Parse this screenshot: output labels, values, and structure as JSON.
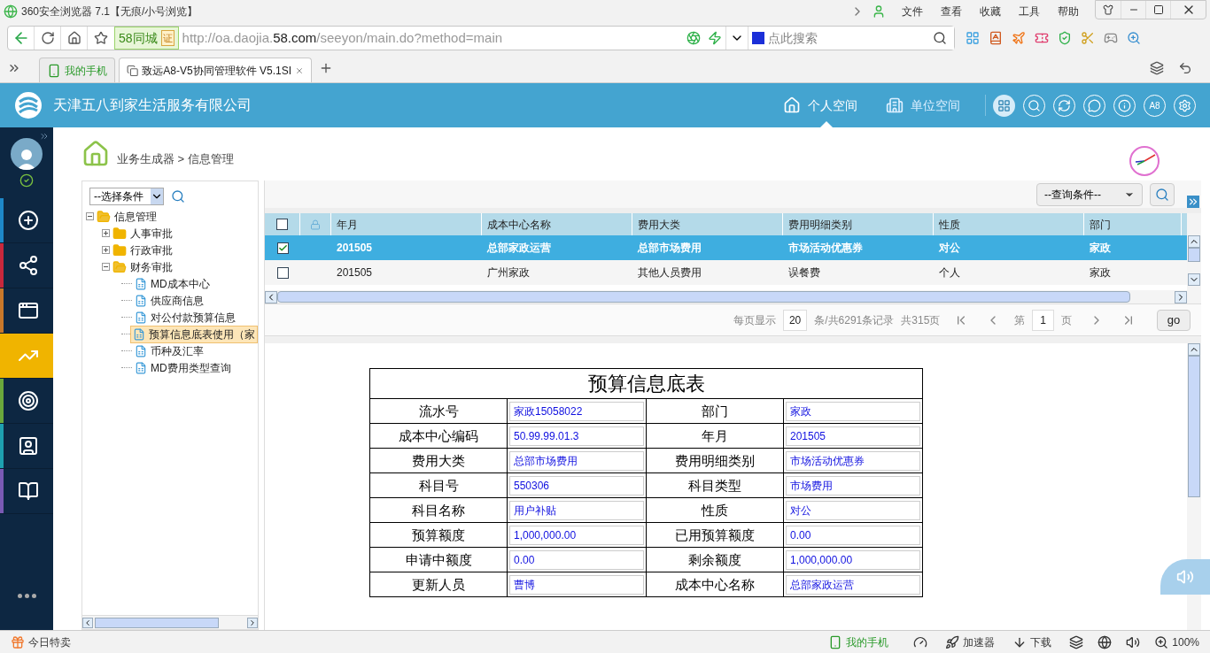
{
  "browser": {
    "title": "360安全浏览器 7.1【无痕/小号浏览】",
    "menu": [
      "文件",
      "查看",
      "收藏",
      "工具",
      "帮助"
    ],
    "site_badge": "58同城",
    "cert": "证",
    "url_before": "http://oa.daojia.",
    "url_domain": "58.com",
    "url_after": "/seeyon/main.do?method=main",
    "search_placeholder": "点此搜索"
  },
  "tabs": [
    {
      "label": "我的手机",
      "kind": "phone",
      "selected": false
    },
    {
      "label": "致远A8-V5协同管理软件 V5.1SI",
      "kind": "page",
      "selected": true
    }
  ],
  "app": {
    "company": "天津五八到家生活服务有限公司",
    "spaces": [
      {
        "label": "个人空间",
        "kind": "home",
        "selected": true
      },
      {
        "label": "单位空间",
        "kind": "building",
        "selected": false
      }
    ],
    "tools": [
      {
        "kind": "grid",
        "selected": true
      },
      {
        "kind": "search",
        "selected": false
      },
      {
        "kind": "refresh",
        "selected": false
      },
      {
        "kind": "chat",
        "selected": false
      },
      {
        "kind": "info",
        "selected": false
      },
      {
        "kind": "text",
        "label": "A8",
        "selected": false
      },
      {
        "kind": "settings",
        "selected": false
      }
    ]
  },
  "nav": [
    {
      "kind": "add",
      "color": "#1e88c8",
      "selected": false
    },
    {
      "kind": "flow",
      "color": "#c8283c",
      "selected": false
    },
    {
      "kind": "window",
      "color": "#c8782a",
      "selected": false
    },
    {
      "kind": "chart",
      "color": "#f0b400",
      "selected": true
    },
    {
      "kind": "target",
      "color": "#6aa83c",
      "selected": false
    },
    {
      "kind": "person",
      "color": "#1ea0b0",
      "selected": false
    },
    {
      "kind": "book",
      "color": "#7a5ab4",
      "selected": false
    }
  ],
  "breadcrumb": "业务生成器 > 信息管理",
  "tree": {
    "filter": "--选择条件",
    "root": {
      "label": "信息管理",
      "expanded": true,
      "children": [
        {
          "label": "人事审批",
          "expanded": false
        },
        {
          "label": "行政审批",
          "expanded": false
        },
        {
          "label": "财务审批",
          "expanded": true,
          "children": [
            {
              "label": "MD成本中心",
              "selected": false
            },
            {
              "label": "供应商信息",
              "selected": false
            },
            {
              "label": "对公付款预算信息",
              "selected": false
            },
            {
              "label": "预算信息底表使用（家",
              "selected": true
            },
            {
              "label": "币种及汇率",
              "selected": false
            },
            {
              "label": "MD费用类型查询",
              "selected": false
            }
          ]
        }
      ]
    }
  },
  "grid": {
    "query": "--查询条件--",
    "all_checked": false,
    "columns": [
      "年月",
      "成本中心名称",
      "费用大类",
      "费用明细类别",
      "性质",
      "部门"
    ],
    "rows": [
      {
        "checked": true,
        "selected": true,
        "cells": [
          "201505",
          "总部家政运营",
          "总部市场费用",
          "市场活动优惠券",
          "对公",
          "家政"
        ]
      },
      {
        "checked": false,
        "selected": false,
        "cells": [
          "201505",
          "广州家政",
          "其他人员费用",
          "误餐费",
          "个人",
          "家政"
        ]
      }
    ],
    "pager": {
      "per_page_label": "每页显示",
      "per_page": "20",
      "records": "条/共6291条记录",
      "pages": "共315页",
      "page_label": "第",
      "page": "1",
      "page_unit": "页",
      "go": "go"
    }
  },
  "form": {
    "title": "预算信息底表",
    "rows": [
      [
        "流水号",
        "家政15058022",
        "部门",
        "家政"
      ],
      [
        "成本中心编码",
        "50.99.99.01.3",
        "年月",
        "201505"
      ],
      [
        "费用大类",
        "总部市场费用",
        "费用明细类别",
        "市场活动优惠券"
      ],
      [
        "科目号",
        "550306",
        "科目类型",
        "市场费用"
      ],
      [
        "科目名称",
        "用户补贴",
        "性质",
        "对公"
      ],
      [
        "预算额度",
        "1,000,000.00",
        "已用预算额度",
        "0.00"
      ],
      [
        "申请中额度",
        "0.00",
        "剩余额度",
        "1,000,000.00"
      ],
      [
        "更新人员",
        "曹博",
        "成本中心名称",
        "总部家政运营"
      ]
    ]
  },
  "status_bar": {
    "left": "今日特卖",
    "phone": "我的手机",
    "accelerator": "加速器",
    "download": "下载",
    "zoom": "100%"
  }
}
